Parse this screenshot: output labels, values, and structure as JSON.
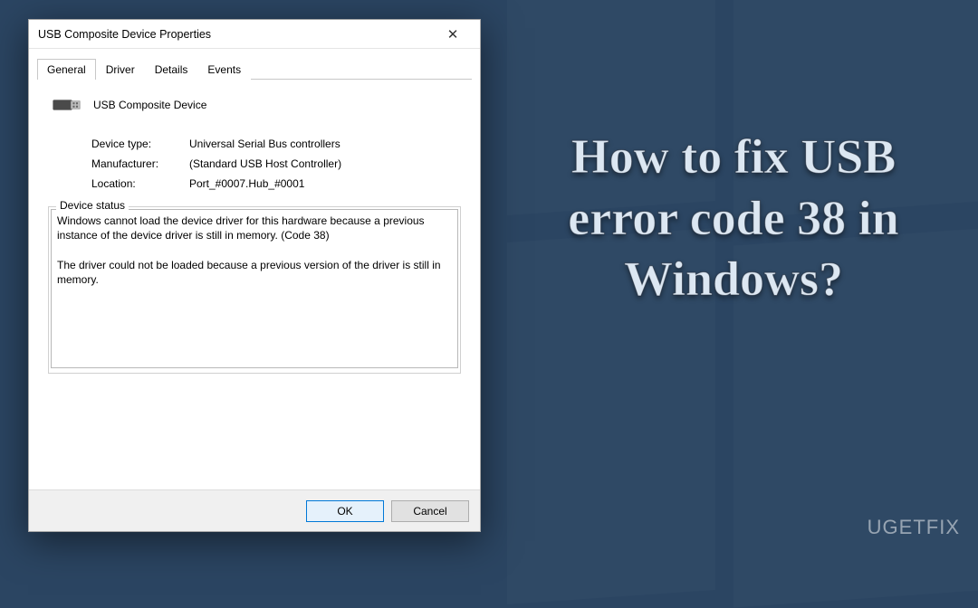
{
  "background": {
    "headline": "How to fix USB error code 38 in Windows?",
    "watermark": "UGETFIX"
  },
  "dialog": {
    "title": "USB Composite Device Properties",
    "tabs": [
      "General",
      "Driver",
      "Details",
      "Events"
    ],
    "active_tab": "General",
    "device_name": "USB Composite Device",
    "info": {
      "device_type_label": "Device type:",
      "device_type_value": "Universal Serial Bus controllers",
      "manufacturer_label": "Manufacturer:",
      "manufacturer_value": "(Standard USB Host Controller)",
      "location_label": "Location:",
      "location_value": "Port_#0007.Hub_#0001"
    },
    "status_group_label": "Device status",
    "status_text": "Windows cannot load the device driver for this hardware because a previous instance of the device driver is still in memory. (Code 38)\n\nThe driver could not be loaded because a previous version of the driver is still in memory.",
    "buttons": {
      "ok": "OK",
      "cancel": "Cancel"
    }
  }
}
